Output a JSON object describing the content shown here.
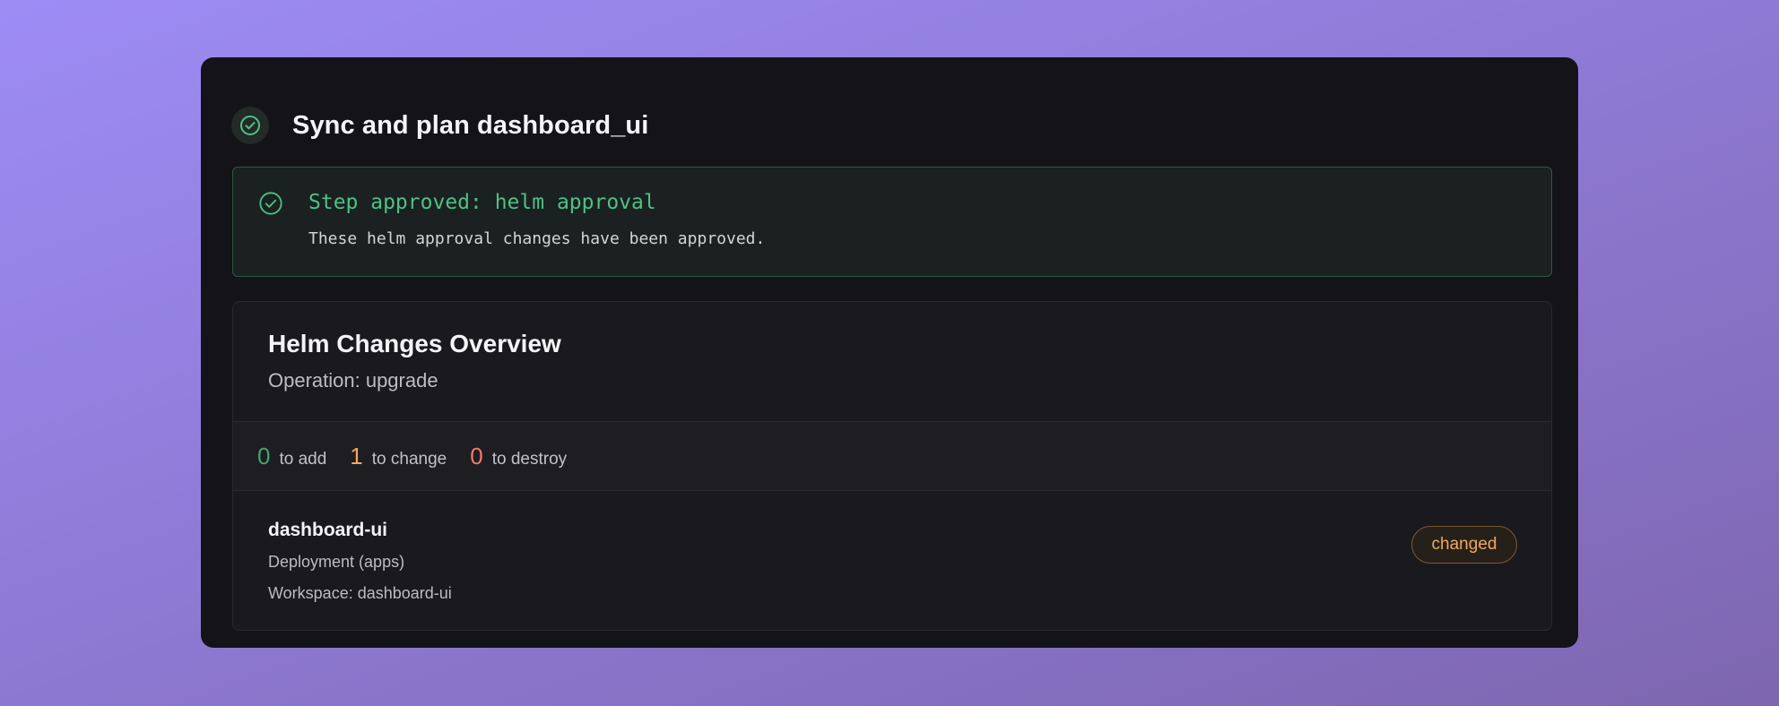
{
  "header": {
    "title": "Sync and plan dashboard_ui",
    "icon": "check-circle-icon"
  },
  "approval": {
    "title": "Step approved: helm approval",
    "message": "These helm approval changes have been approved.",
    "icon": "check-circle-icon"
  },
  "overview": {
    "title": "Helm Changes Overview",
    "operation": "Operation: upgrade",
    "counts": [
      {
        "value": "0",
        "label": "to add",
        "color": "#3fa66b"
      },
      {
        "value": "1",
        "label": "to change",
        "color": "#f0a95a"
      },
      {
        "value": "0",
        "label": "to destroy",
        "color": "#f07a6a"
      }
    ],
    "resource": {
      "name": "dashboard-ui",
      "type": "Deployment (apps)",
      "workspace": "Workspace: dashboard-ui",
      "status": "changed"
    }
  },
  "colors": {
    "accent_green": "#4fc085",
    "changed_orange": "#f0a95a"
  }
}
